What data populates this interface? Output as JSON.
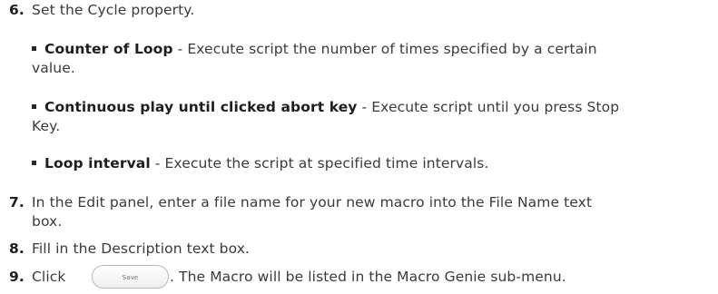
{
  "steps": {
    "s6": {
      "num": "6.",
      "text": "Set the Cycle property."
    },
    "bullets": [
      {
        "label": "Counter of Loop",
        "text1": " - Execute script the number of times specified by a certain",
        "text2": "value."
      },
      {
        "label": "Continuous play until clicked abort key",
        "text1": " -  Execute script until you press Stop",
        "text2": "Key."
      },
      {
        "label": "Loop interval",
        "text1": " - Execute the script at specified time intervals."
      }
    ],
    "s7": {
      "num": "7.",
      "text1": "In the Edit panel, enter a file name for your new macro into the File Name text",
      "text2": "box."
    },
    "s8": {
      "num": "8.",
      "text": "Fill in the Description text box."
    },
    "s9": {
      "num": "9.",
      "click": "Click",
      "button_label": "Save",
      "after": ". The Macro will be listed in the Macro Genie sub-menu."
    }
  }
}
